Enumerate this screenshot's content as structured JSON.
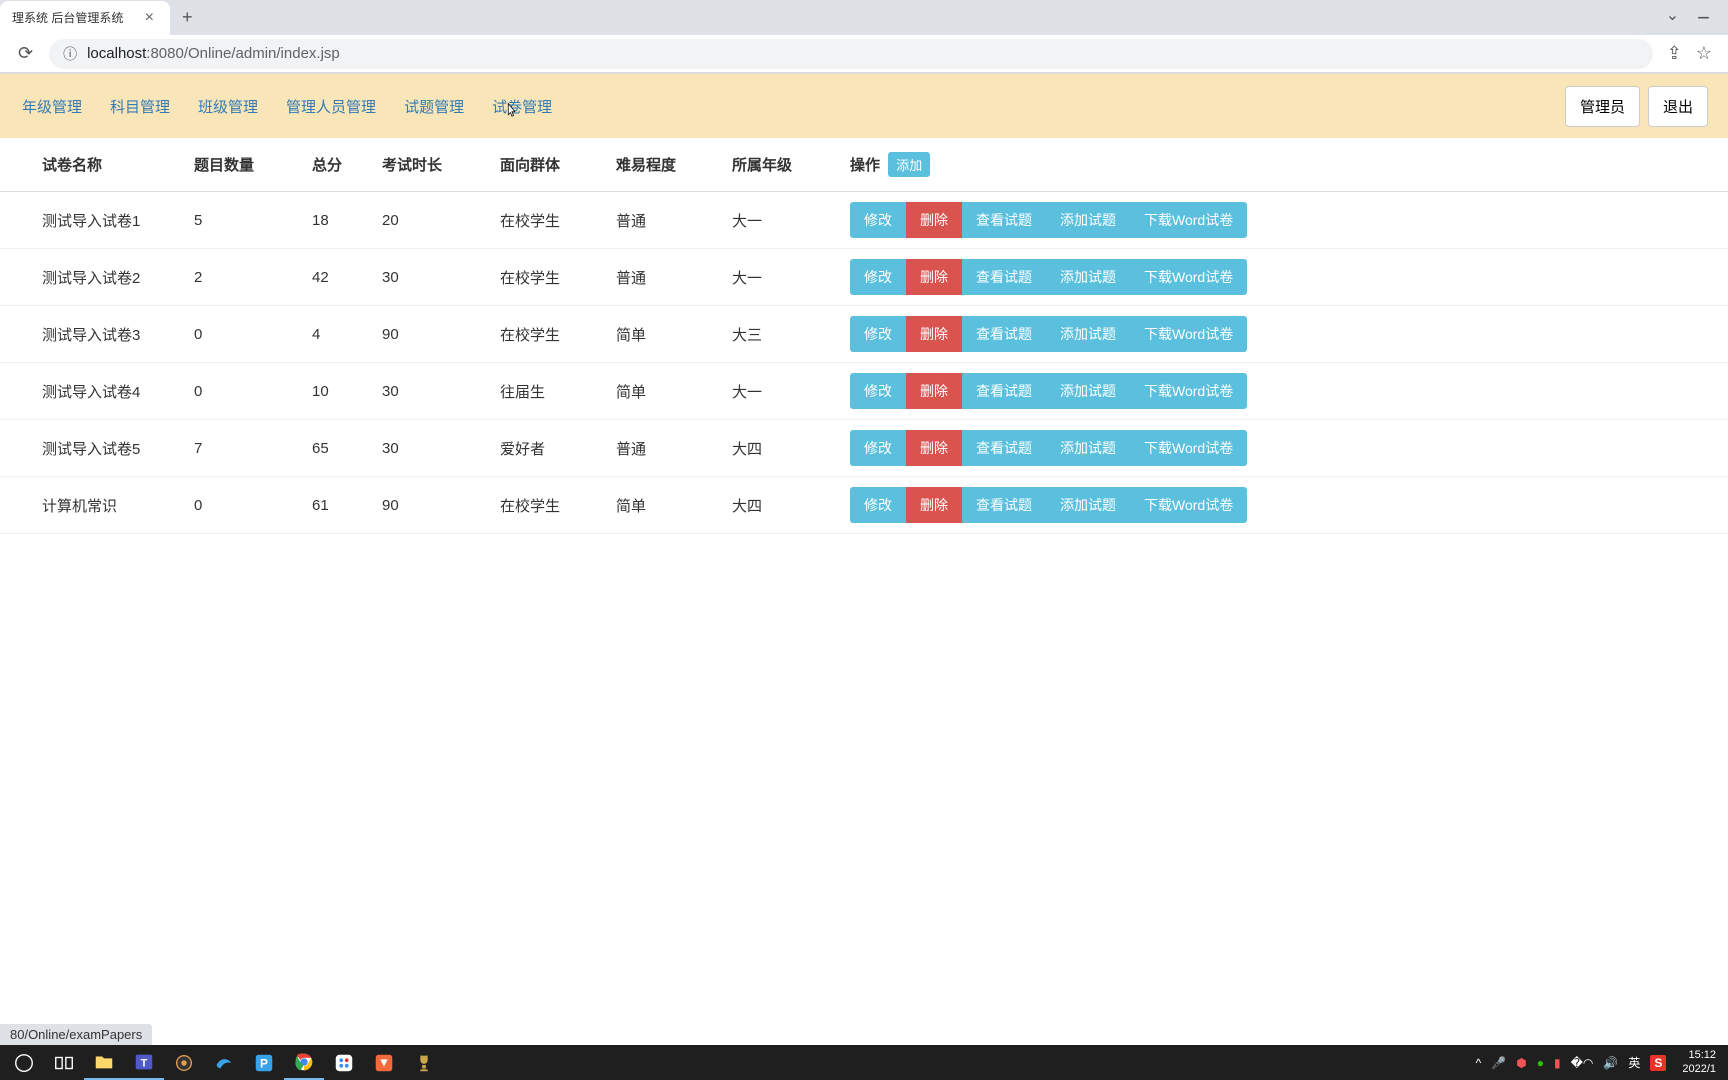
{
  "browser": {
    "tab_title": "理系统 后台管理系统",
    "url_host": "localhost",
    "url_port": ":8080",
    "url_path": "/Online/admin/index.jsp",
    "status_link": "80/Online/examPapers"
  },
  "nav": {
    "items": [
      "年级管理",
      "科目管理",
      "班级管理",
      "管理人员管理",
      "试题管理",
      "试卷管理"
    ],
    "admin_btn": "管理员",
    "logout_btn": "退出"
  },
  "table": {
    "headers": {
      "name": "试卷名称",
      "count": "题目数量",
      "total": "总分",
      "duration": "考试时长",
      "audience": "面向群体",
      "difficulty": "难易程度",
      "grade": "所属年级",
      "ops": "操作"
    },
    "add_btn": "添加",
    "actions": {
      "edit": "修改",
      "del": "删除",
      "view": "查看试题",
      "add": "添加试题",
      "download": "下载Word试卷"
    },
    "rows": [
      {
        "name": "测试导入试卷1",
        "count": "5",
        "total": "18",
        "duration": "20",
        "audience": "在校学生",
        "difficulty": "普通",
        "grade": "大一"
      },
      {
        "name": "测试导入试卷2",
        "count": "2",
        "total": "42",
        "duration": "30",
        "audience": "在校学生",
        "difficulty": "普通",
        "grade": "大一"
      },
      {
        "name": "测试导入试卷3",
        "count": "0",
        "total": "4",
        "duration": "90",
        "audience": "在校学生",
        "difficulty": "简单",
        "grade": "大三"
      },
      {
        "name": "测试导入试卷4",
        "count": "0",
        "total": "10",
        "duration": "30",
        "audience": "往届生",
        "difficulty": "简单",
        "grade": "大一"
      },
      {
        "name": "测试导入试卷5",
        "count": "7",
        "total": "65",
        "duration": "30",
        "audience": "爱好者",
        "difficulty": "普通",
        "grade": "大四"
      },
      {
        "name": "计算机常识",
        "count": "0",
        "total": "61",
        "duration": "90",
        "audience": "在校学生",
        "difficulty": "简单",
        "grade": "大四"
      }
    ]
  },
  "tray": {
    "ime": "英",
    "time": "15:12",
    "date": "2022/1"
  }
}
